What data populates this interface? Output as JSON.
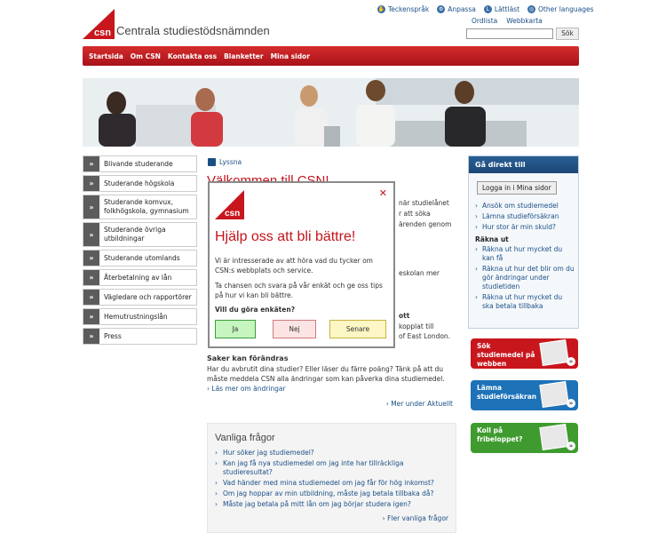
{
  "header": {
    "brand": "Centrala studiestödsnämnden",
    "top_links": [
      {
        "label": "Teckenspråk",
        "icon": "sign-language-icon"
      },
      {
        "label": "Anpassa",
        "icon": "adjust-icon"
      },
      {
        "label": "Lättläst",
        "icon": "easy-read-icon"
      },
      {
        "label": "Other languages",
        "icon": "globe-icon"
      }
    ],
    "secondary_links": [
      "Ordlista",
      "Webbkarta"
    ],
    "search_placeholder": "",
    "search_button": "Sök",
    "logo_text": "csn"
  },
  "nav": [
    "Startsida",
    "Om CSN",
    "Kontakta oss",
    "Blanketter",
    "Mina sidor"
  ],
  "sidebar": [
    "Blivande studerande",
    "Studerande högskola",
    "Studerande komvux, folkhögskola, gymnasium",
    "Studerande övriga utbildningar",
    "Studerande utomlands",
    "Återbetalning av lån",
    "Vägledare och rapportörer",
    "Hemutrustningslån",
    "Press"
  ],
  "main": {
    "listen": "Lyssna",
    "welcome": "Välkommen till CSN!",
    "bg_lines": [
      "när studielånet",
      "r att söka",
      "ärenden genom",
      "eskolan mer",
      "ott",
      "kopplat till",
      "of East London."
    ],
    "news": {
      "title": "Saker kan förändras",
      "text": "Har du avbrutit dina studier? Eller läser du färre poäng? Tänk på att du måste meddela CSN alla ändringar som kan påverka dina studiemedel.",
      "link": "Läs mer om ändringar",
      "more": "Mer under Aktuellt"
    },
    "faq": {
      "title": "Vanliga frågor",
      "items": [
        "Hur söker jag studiemedel?",
        "Kan jag få nya studiemedel om jag inte har tillräckliga studieresultat?",
        "Vad händer med mina studiemedel om jag får för hög inkomst?",
        "Om jag hoppar av min utbildning, måste jag betala tillbaka då?",
        "Måste jag betala på mitt lån om jag börjar studera igen?"
      ],
      "more": "Fler vanliga frågor"
    }
  },
  "right": {
    "title": "Gå direkt till",
    "login": "Logga in i Mina sidor",
    "links1": [
      "Ansök om studiemedel",
      "Lämna studieförsäkran",
      "Hur stor är min skuld?"
    ],
    "sub": "Räkna ut",
    "links2": [
      "Räkna ut hur mycket du kan få",
      "Räkna ut hur det blir om du gör ändringar under studietiden",
      "Räkna ut hur mycket du ska betala tillbaka"
    ],
    "promos": [
      {
        "label": "Sök studiemedel på webben",
        "color": "#c8161d"
      },
      {
        "label": "Lämna studieförsäkran",
        "color": "#1d72b8"
      },
      {
        "label": "Koll på fribeloppet?",
        "color": "#3f9b2f"
      }
    ]
  },
  "modal": {
    "logo_text": "csn",
    "title": "Hjälp oss att bli bättre!",
    "p1": "Vi är intresserade av att höra vad du tycker om CSN:s webbplats och service.",
    "p2": "Ta chansen och svara på vår enkät och ge oss tips på hur vi kan bli bättre.",
    "question": "Vill du göra enkäten?",
    "buttons": [
      {
        "label": "Ja",
        "bg": "#c6f5c0",
        "border": "#3c9d3c"
      },
      {
        "label": "Nej",
        "bg": "#fde4e4",
        "border": "#d07a7a"
      },
      {
        "label": "Senare",
        "bg": "#fdf6c5",
        "border": "#c9b43c"
      }
    ]
  }
}
